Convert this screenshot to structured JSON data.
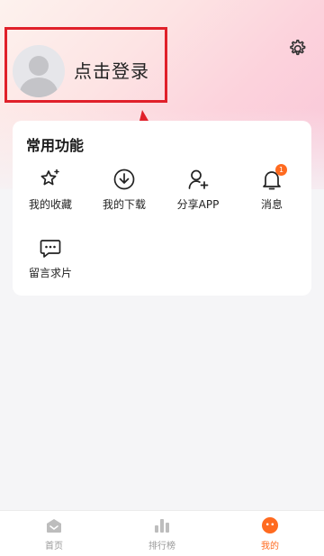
{
  "header": {
    "login_text": "点击登录"
  },
  "functions": {
    "title": "常用功能",
    "items": [
      {
        "label": "我的收藏",
        "icon": "star-sparkle-icon"
      },
      {
        "label": "我的下载",
        "icon": "download-icon"
      },
      {
        "label": "分享APP",
        "icon": "user-add-icon"
      },
      {
        "label": "消息",
        "icon": "bell-icon",
        "badge": "1"
      },
      {
        "label": "留言求片",
        "icon": "message-icon"
      }
    ]
  },
  "tabbar": {
    "items": [
      {
        "label": "首页",
        "icon": "home-icon",
        "active": false
      },
      {
        "label": "排行榜",
        "icon": "ranking-icon",
        "active": false
      },
      {
        "label": "我的",
        "icon": "profile-face-icon",
        "active": true
      }
    ]
  },
  "colors": {
    "accent": "#ff6a1f",
    "annotation_red": "#e0202a"
  }
}
